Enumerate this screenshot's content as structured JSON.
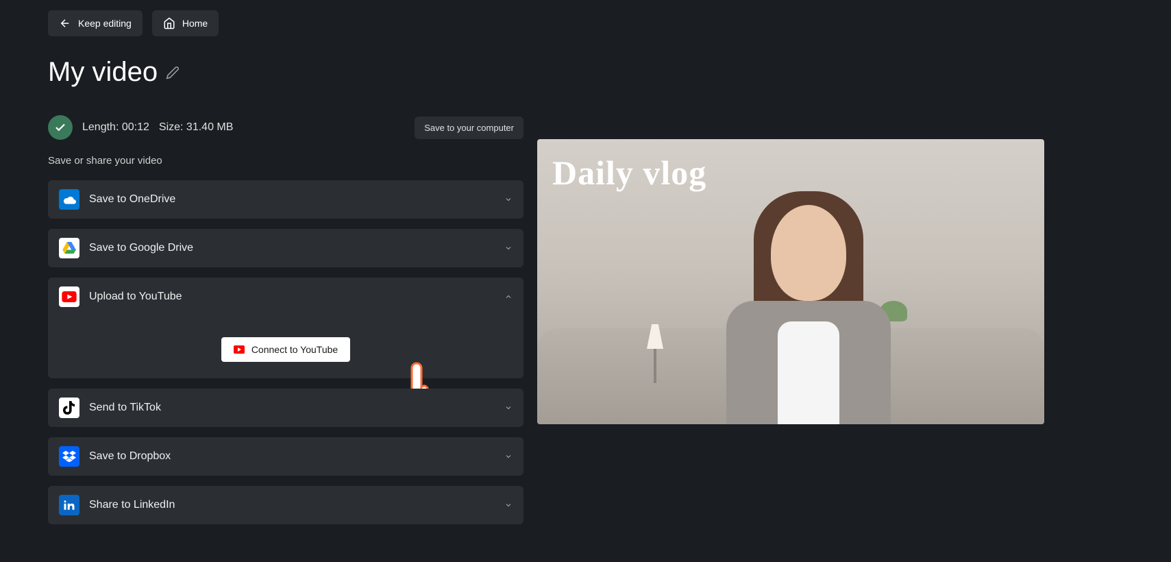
{
  "header": {
    "keep_editing_label": "Keep editing",
    "home_label": "Home"
  },
  "video": {
    "title": "My video",
    "length_label": "Length:",
    "length_value": "00:12",
    "size_label": "Size:",
    "size_value": "31.40 MB",
    "save_computer_label": "Save to your computer",
    "section_label": "Save or share your video",
    "preview_text": "Daily vlog"
  },
  "share_options": {
    "onedrive": {
      "label": "Save to OneDrive"
    },
    "gdrive": {
      "label": "Save to Google Drive"
    },
    "youtube": {
      "label": "Upload to YouTube",
      "connect_label": "Connect to YouTube"
    },
    "tiktok": {
      "label": "Send to TikTok"
    },
    "dropbox": {
      "label": "Save to Dropbox"
    },
    "linkedin": {
      "label": "Share to LinkedIn"
    }
  }
}
